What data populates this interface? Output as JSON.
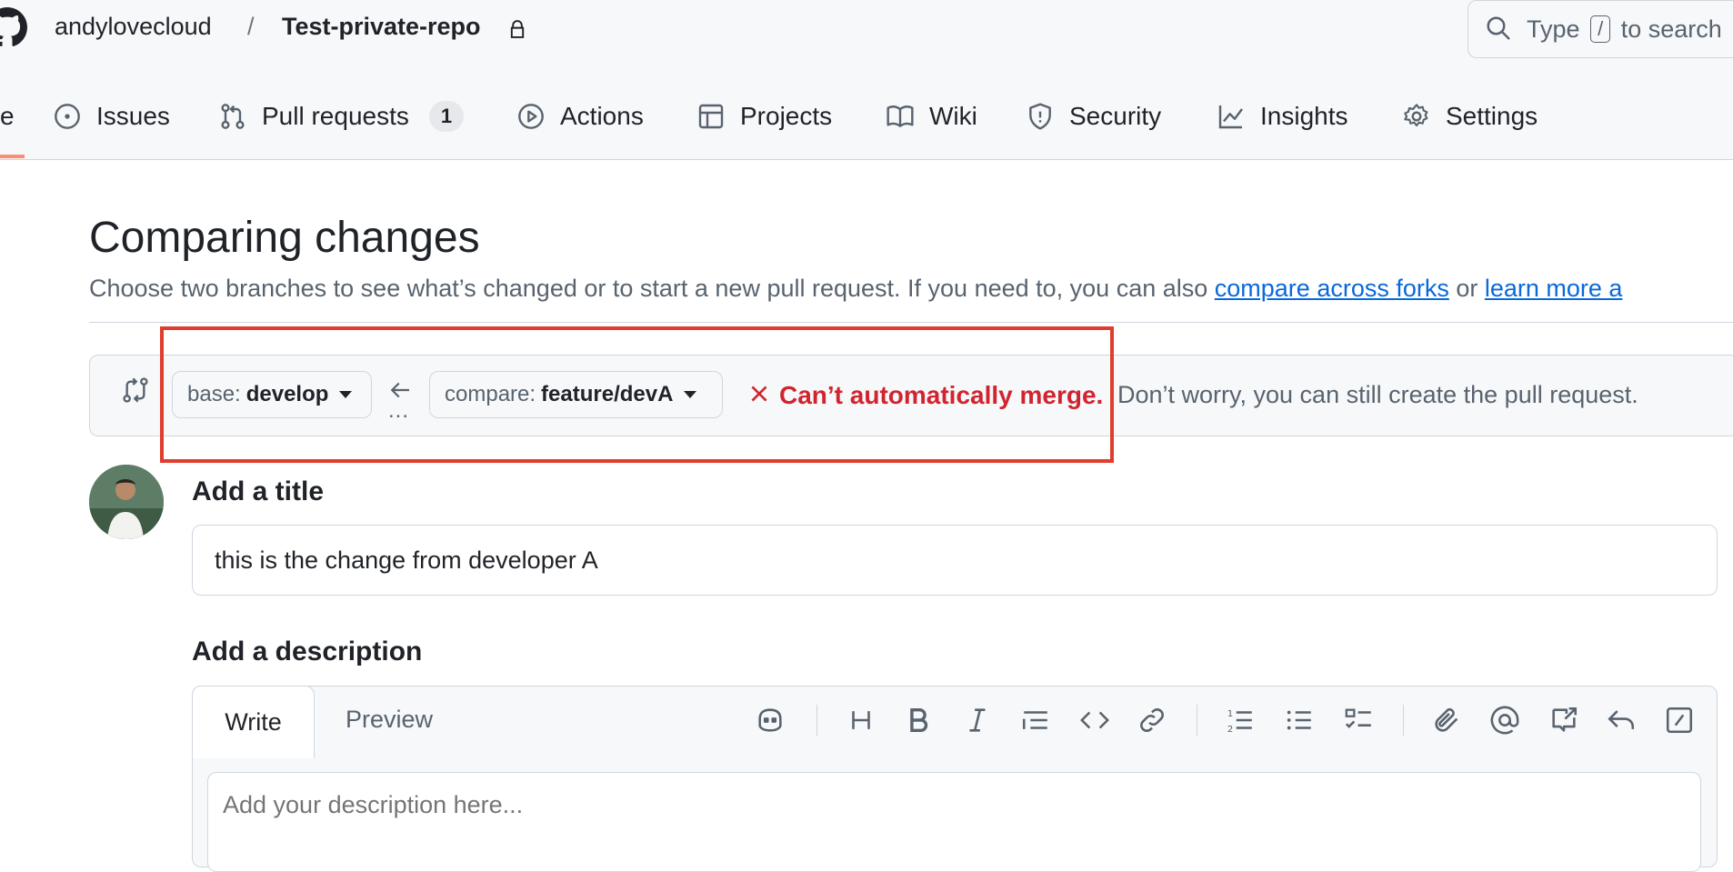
{
  "header": {
    "owner": "andylovecloud",
    "separator": "/",
    "repo": "Test-private-repo",
    "search": {
      "prefix": "Type",
      "key": "/",
      "suffix": "to search"
    }
  },
  "nav": {
    "partial_label": "e",
    "issues": "Issues",
    "pull_requests": "Pull requests",
    "pull_requests_count": "1",
    "actions": "Actions",
    "projects": "Projects",
    "wiki": "Wiki",
    "security": "Security",
    "insights": "Insights",
    "settings": "Settings"
  },
  "compare": {
    "title": "Comparing changes",
    "subtitle_text": "Choose two branches to see what’s changed or to start a new pull request. If you need to, you can also ",
    "link_forks": "compare across forks",
    "subtitle_or": " or ",
    "link_learn": "learn more a",
    "base_label": "base:",
    "base_value": "develop",
    "compare_label": "compare:",
    "compare_value": "feature/devA",
    "dots": "...",
    "merge_status": "Can’t automatically merge.",
    "merge_note": "Don’t worry, you can still create the pull request."
  },
  "form": {
    "title_label": "Add a title",
    "title_value": "this is the change from developer A",
    "description_label": "Add a description",
    "tab_write": "Write",
    "tab_preview": "Preview",
    "description_placeholder": "Add your description here..."
  },
  "colors": {
    "accent_link": "#0969da",
    "error": "#d1242f",
    "highlight_box": "#e03e2d",
    "nav_underline": "#fd8c73"
  }
}
